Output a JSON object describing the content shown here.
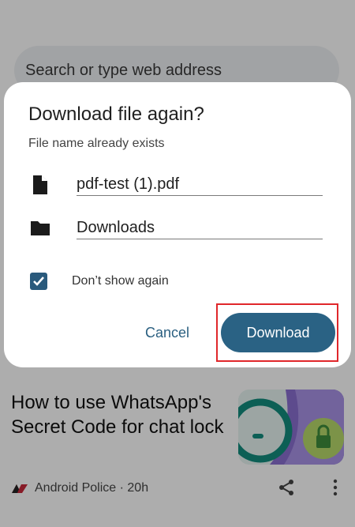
{
  "search": {
    "placeholder": "Search or type web address"
  },
  "article": {
    "title": "How to use WhatsApp's Secret Code for chat lock",
    "source": "Android Police",
    "age": "20h",
    "meta_separator": " · "
  },
  "dialog": {
    "title": "Download file again?",
    "subtitle": "File name already exists",
    "file_name": "pdf-test (1).pdf",
    "folder": "Downloads",
    "checkbox_label": "Don’t show again",
    "checkbox_checked": true,
    "cancel_label": "Cancel",
    "download_label": "Download"
  },
  "icons": {
    "file": "file-icon",
    "folder": "folder-icon",
    "checkbox": "check-icon",
    "share": "share-icon",
    "more": "more-vert-icon",
    "source_logo": "android-police-logo"
  },
  "colors": {
    "accent": "#2a6284",
    "cancel_text": "#2a5f80",
    "highlight": "#e0272b"
  }
}
